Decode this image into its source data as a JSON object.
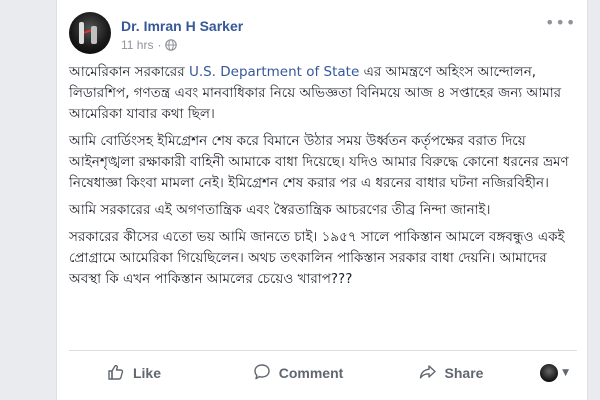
{
  "post": {
    "author": "Dr. Imran H Sarker",
    "time": "11 hrs",
    "separator": "·",
    "paragraphs": {
      "p1_prefix": "আমেরিকান সরকারের ",
      "p1_link": "U.S. Department of State",
      "p1_suffix": " এর আমন্ত্রণে অহিংস আন্দোলন, লিডারশিপ, গণতন্ত্র এবং মানবাধিকার নিয়ে অভিজ্ঞতা বিনিময়ে আজ ৪ সপ্তাহের জন্য আমার আমেরিকা যাবার কথা ছিল।",
      "p2": "আমি বোর্ডিংসহ ইমিগ্রেশন শেষ করে বিমানে উঠার সময় উর্ধ্বতন কর্তৃপক্ষের বরাত দিয়ে আইনশৃঙ্খলা রক্ষাকারী বাহিনী আমাকে বাধা দিয়েছে। যদিও আমার বিরুদ্ধে কোনো ধরনের ভ্রমণ নিষেধাজ্ঞা কিংবা মামলা নেই। ইমিগ্রেশন শেষ করার পর এ ধরনের বাধার ঘটনা নজিরবিহীন।",
      "p3": "আমি সরকারের এই অগণতান্ত্রিক এবং স্বৈরতান্ত্রিক আচরণের তীব্র নিন্দা জানাই।",
      "p4": "সরকারের কীসের এতো ভয় আমি জানতে চাই। ১৯৫৭ সালে পাকিস্তান আমলে বঙ্গবন্ধুও একই প্রোগ্রামে আমেরিকা গিয়েছিলেন। অথচ তৎকালিন পাকিস্তান সরকার বাধা দেয়নি। আমাদের অবস্থা কি এখন পাকিস্তান আমলের চেয়েও খারাপ???"
    }
  },
  "actions": {
    "like": "Like",
    "comment": "Comment",
    "share": "Share"
  },
  "colors": {
    "link": "#365899",
    "text": "#1d2129",
    "muted": "#90949c",
    "action": "#606770"
  },
  "icons": {
    "audience": "globe-icon",
    "menu": "more-options-icon",
    "like": "thumbs-up-icon",
    "comment": "comment-bubble-icon",
    "share": "share-arrow-icon"
  }
}
